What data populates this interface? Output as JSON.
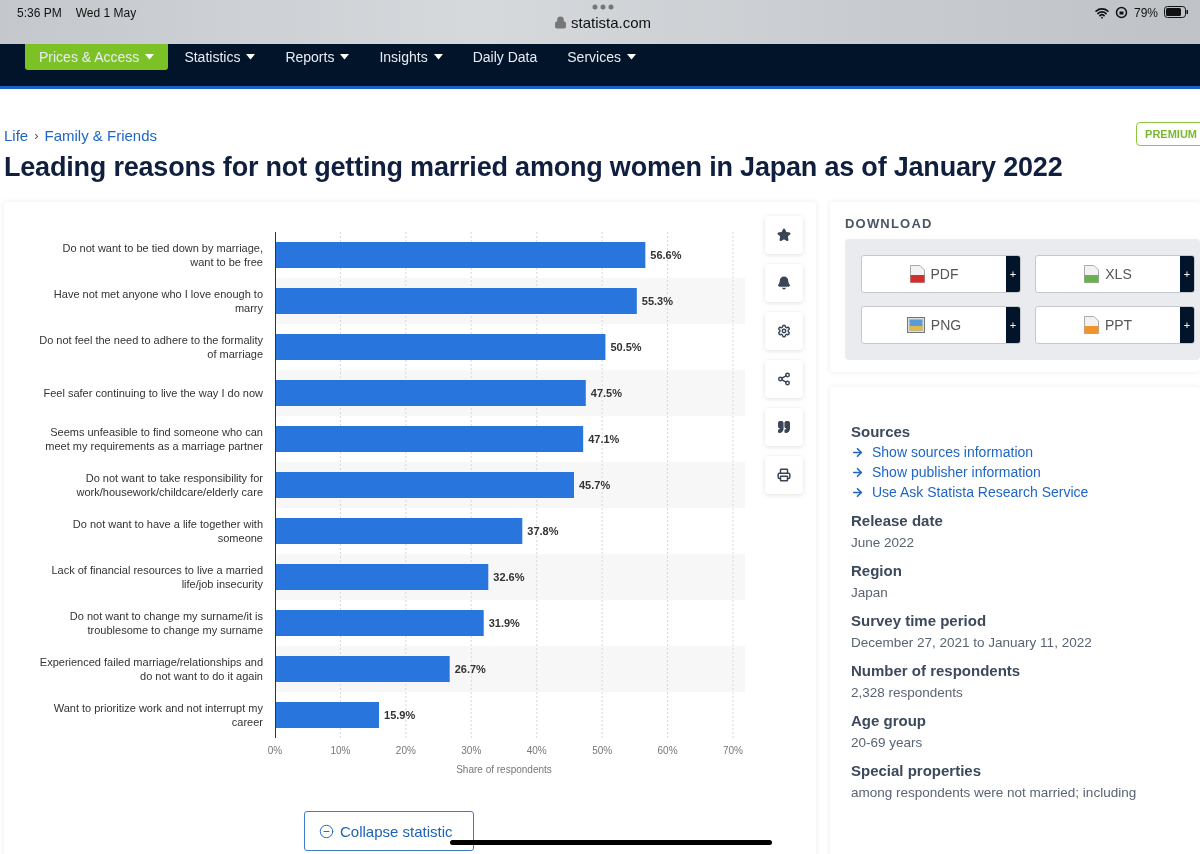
{
  "status_bar": {
    "time": "5:36 PM",
    "date": "Wed 1 May",
    "url": "statista.com",
    "battery": "79%"
  },
  "nav": {
    "items": [
      {
        "label": "Prices & Access",
        "highlighted": true,
        "dropdown": true
      },
      {
        "label": "Statistics",
        "highlighted": false,
        "dropdown": true
      },
      {
        "label": "Reports",
        "highlighted": false,
        "dropdown": true
      },
      {
        "label": "Insights",
        "highlighted": false,
        "dropdown": true
      },
      {
        "label": "Daily Data",
        "highlighted": false,
        "dropdown": false
      },
      {
        "label": "Services",
        "highlighted": false,
        "dropdown": true
      }
    ]
  },
  "breadcrumb": [
    {
      "label": "Life",
      "separator": "›"
    },
    {
      "label": "Family & Friends"
    }
  ],
  "badge": "PREMIUM",
  "title": "Leading reasons for not getting married among women in Japan as of January 2022",
  "statistic": {
    "chart_data": {
      "type": "bar",
      "orientation": "horizontal",
      "xlabel": "Share of respondents",
      "categories": [
        "Do not want to be tied down by marriage, want to be free",
        "Have not met anyone who I love enough to marry",
        "Do not feel the need to adhere to the formality of marriage",
        "Feel safer continuing to live the way I do now",
        "Seems unfeasible to find someone who can meet my requirements as a marriage partner",
        "Do not want to take responsibility for work/housework/childcare/elderly care",
        "Do not want to have a life together with someone",
        "Lack of financial resources to live a married life/job insecurity",
        "Do not want to change my surname/it is troublesome to change my surname",
        "Experienced failed marriage/relationships and do not want to do it again",
        "Want to prioritize work and not interrupt my career"
      ],
      "grid": true,
      "series": [
        {
          "color": "#2876dd",
          "values": [
            56.6,
            55.3,
            50.5,
            47.5,
            47.1,
            45.7,
            37.8,
            32.6,
            31.9,
            26.7,
            15.9
          ]
        }
      ],
      "value_labels": [
        "56.6%",
        "55.3%",
        "50.5%",
        "47.5%",
        "47.1%",
        "45.7%",
        "37.8%",
        "32.6%",
        "31.9%",
        "26.7%",
        "15.9%"
      ],
      "xlim": [
        0,
        70
      ],
      "xticks": [
        {
          "value": 0,
          "label": "0%"
        },
        {
          "value": 10,
          "label": "10%"
        },
        {
          "value": 20,
          "label": "20%"
        },
        {
          "value": 30,
          "label": "30%"
        },
        {
          "value": 40,
          "label": "40%"
        },
        {
          "value": 50,
          "label": "50%"
        },
        {
          "value": 60,
          "label": "60%"
        },
        {
          "value": 70,
          "label": "70%"
        }
      ]
    },
    "collapse_button": "Collapse statistic"
  },
  "download": {
    "title": "DOWNLOAD",
    "formats": [
      {
        "label": "PDF",
        "kind": "pdf",
        "more": "+"
      },
      {
        "label": "XLS",
        "kind": "xls",
        "more": "+"
      },
      {
        "label": "PNG",
        "kind": "png",
        "more": "+"
      },
      {
        "label": "PPT",
        "kind": "ppt",
        "more": "+"
      }
    ]
  },
  "details": {
    "sources": {
      "heading": "Sources",
      "links": [
        "Show sources information",
        "Show publisher information",
        "Use Ask Statista Research Service"
      ]
    },
    "fields": [
      {
        "heading": "Release date",
        "value": "June 2022"
      },
      {
        "heading": "Region",
        "value": "Japan"
      },
      {
        "heading": "Survey time period",
        "value": "December 27, 2021 to January 11, 2022"
      },
      {
        "heading": "Number of respondents",
        "value": "2,328 respondents"
      },
      {
        "heading": "Age group",
        "value": "20-69 years"
      },
      {
        "heading": "Special properties",
        "value": "among respondents were not married; including"
      }
    ]
  }
}
